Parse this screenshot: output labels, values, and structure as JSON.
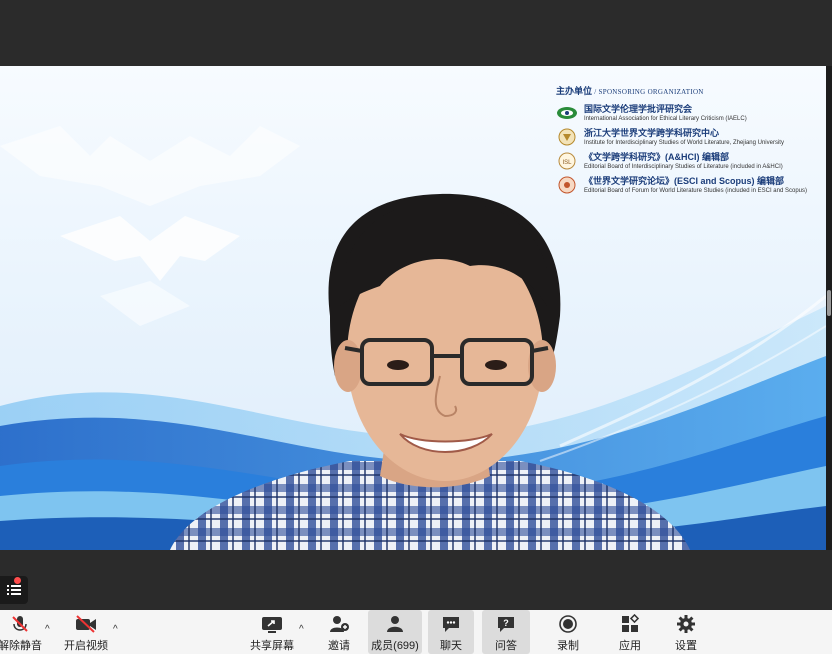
{
  "sponsor": {
    "heading_cn": "主办单位",
    "heading_en": "/ SPONSORING ORGANIZATION",
    "orgs": [
      {
        "cn": "国际文学伦理学批评研究会",
        "en": "International Association for Ethical Literary Criticism (IAELC)"
      },
      {
        "cn": "浙江大学世界文学跨学科研究中心",
        "en": "Institute for Interdisciplinary Studies of World Literature, Zhejiang University"
      },
      {
        "cn": "《文学跨学科研究》(A&HCI) 编辑部",
        "en": "Editorial Board of Interdisciplinary Studies of Literature (included in A&HCI)"
      },
      {
        "cn": "《世界文学研究论坛》(ESCI and Scopus) 编辑部",
        "en": "Editorial Board of Forum for World Literature Studies (included in ESCI and Scopus)"
      }
    ]
  },
  "toolbar": {
    "unmute": "解除静音",
    "start_video": "开启视频",
    "share_screen": "共享屏幕",
    "invite": "邀请",
    "members": "成员(699)",
    "chat": "聊天",
    "qa": "问答",
    "record": "录制",
    "apps": "应用",
    "settings": "设置"
  },
  "colors": {
    "toolbar_bg": "#f5f5f5",
    "dark_bg": "#2b2b2b",
    "accent_blue": "#1b6fd1",
    "alert_red": "#ff4d4d"
  }
}
